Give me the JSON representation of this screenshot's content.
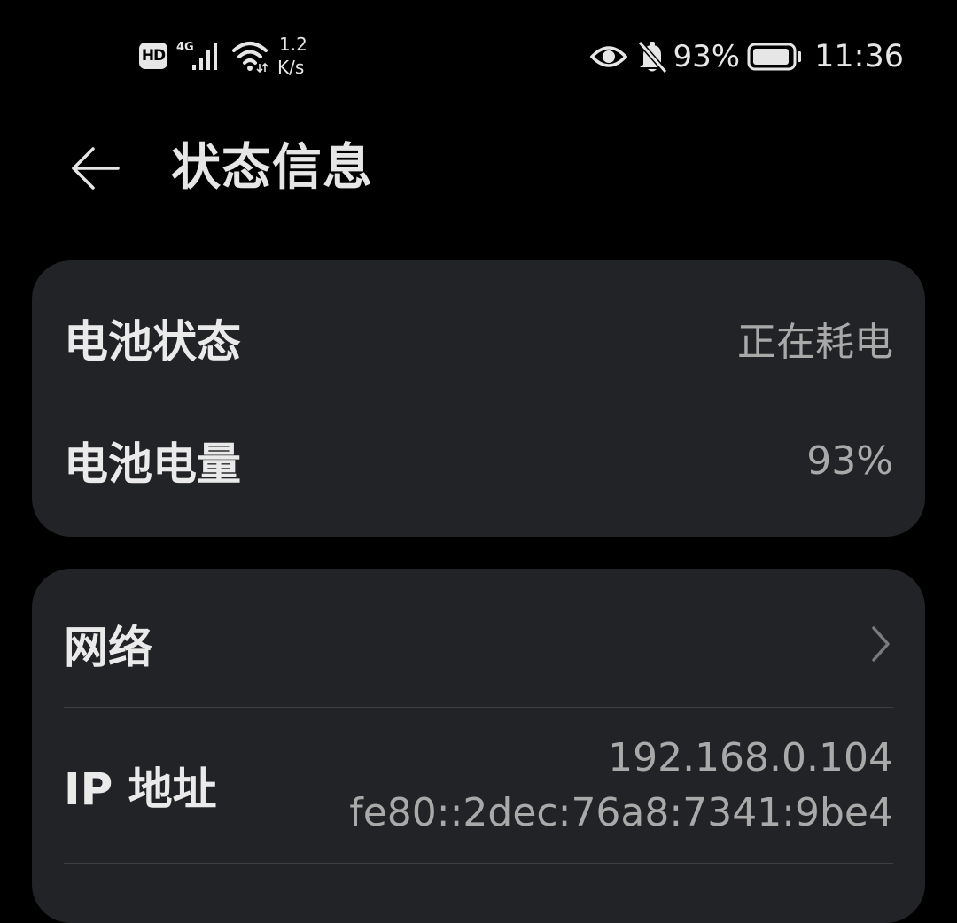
{
  "status_bar": {
    "hd_badge": "HD",
    "network_type": "4G",
    "speed_value": "1.2",
    "speed_unit": "K/s",
    "battery_percent": "93%",
    "time": "11:36"
  },
  "header": {
    "title": "状态信息"
  },
  "battery_card": {
    "status_label": "电池状态",
    "status_value": "正在耗电",
    "level_label": "电池电量",
    "level_value": "93%"
  },
  "network_card": {
    "network_label": "网络",
    "ip_label": "IP 地址",
    "ipv4": "192.168.0.104",
    "ipv6": "fe80::2dec:76a8:7341:9be4"
  },
  "icons": {
    "back": "arrow-left-icon",
    "chevron": "chevron-right-icon",
    "wifi": "wifi-icon",
    "signal": "cell-signal-icon",
    "eye": "eye-icon",
    "bell": "bell-off-icon",
    "battery": "battery-icon"
  },
  "colors": {
    "background": "#000000",
    "card": "#222326",
    "primary_text": "#eaeaea",
    "secondary_text": "#a9a9a9",
    "divider": "#3e3f42"
  }
}
